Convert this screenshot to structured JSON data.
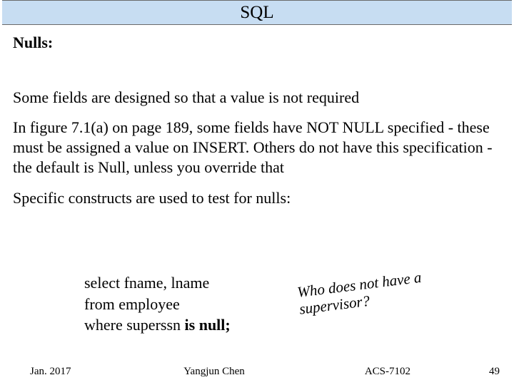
{
  "title": "SQL",
  "subheading": "Nulls:",
  "paragraphs": {
    "p1": "Some fields are designed so that a value is not required",
    "p2": "In figure 7.1(a) on page 189, some fields have NOT NULL specified - these must be assigned a value on INSERT. Others do not have this specification - the default is Null, unless you override that",
    "p3": "Specific constructs are used to test for nulls:"
  },
  "code": {
    "l1": "select fname, lname",
    "l2": "from employee",
    "l3a": "where superssn ",
    "l3b": "is null;"
  },
  "annotation": {
    "l1": "Who does not have a",
    "l2": "supervisor?"
  },
  "footer": {
    "left": "Jan. 2017",
    "center": "Yangjun Chen",
    "course": "ACS-7102",
    "page": "49"
  }
}
